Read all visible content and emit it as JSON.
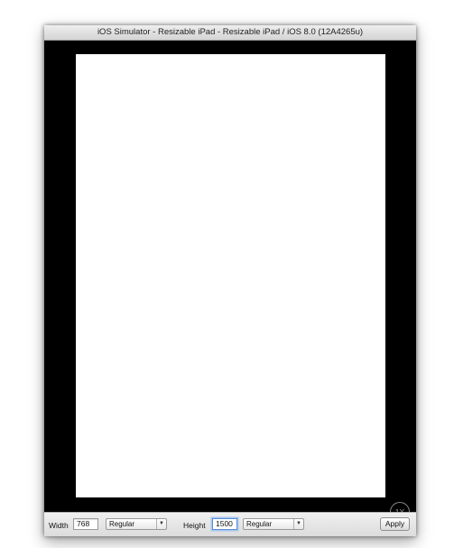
{
  "window": {
    "title": "iOS Simulator - Resizable iPad - Resizable iPad / iOS 8.0 (12A4265u)"
  },
  "simulator": {
    "scale_badge": "1X"
  },
  "controls": {
    "width_label": "Width",
    "width_value": "768",
    "width_size_class": "Regular",
    "height_label": "Height",
    "height_value": "1500",
    "height_size_class": "Regular",
    "apply_label": "Apply"
  },
  "icons": {
    "dropdown": "chevron-down-icon"
  }
}
